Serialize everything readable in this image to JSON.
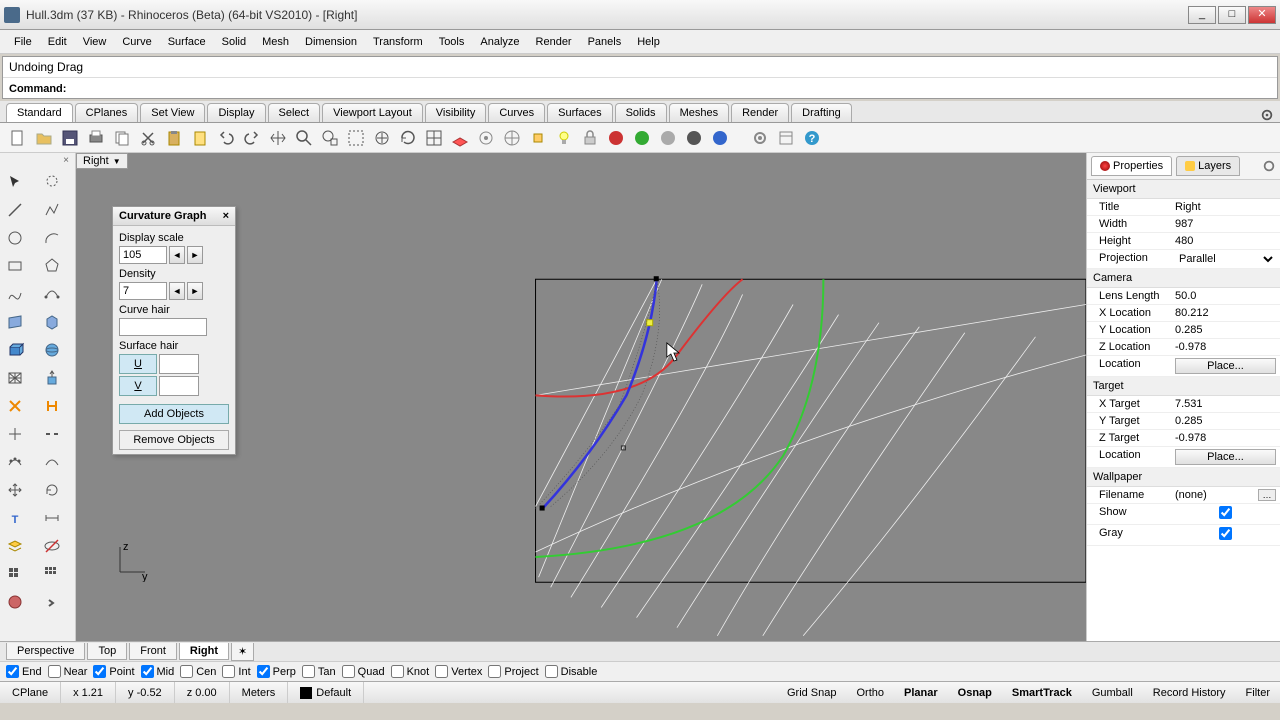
{
  "window": {
    "title": "Hull.3dm (37 KB) - Rhinoceros (Beta) (64-bit VS2010) - [Right]"
  },
  "menu": [
    "File",
    "Edit",
    "View",
    "Curve",
    "Surface",
    "Solid",
    "Mesh",
    "Dimension",
    "Transform",
    "Tools",
    "Analyze",
    "Render",
    "Panels",
    "Help"
  ],
  "command_history": "Undoing Drag",
  "command_prompt": "Command:",
  "toolbar_tabs": [
    "Standard",
    "CPlanes",
    "Set View",
    "Display",
    "Select",
    "Viewport Layout",
    "Visibility",
    "Curves",
    "Surfaces",
    "Solids",
    "Meshes",
    "Render",
    "Drafting"
  ],
  "viewport_label": "Right",
  "curvature_graph": {
    "title": "Curvature Graph",
    "display_scale_label": "Display scale",
    "display_scale": "105",
    "density_label": "Density",
    "density": "7",
    "curve_hair_label": "Curve hair",
    "surface_hair_label": "Surface hair",
    "u_label": "U",
    "v_label": "V",
    "add": "Add Objects",
    "remove": "Remove Objects"
  },
  "prop_tabs": {
    "properties": "Properties",
    "layers": "Layers"
  },
  "properties": {
    "viewport_section": "Viewport",
    "title_k": "Title",
    "title_v": "Right",
    "width_k": "Width",
    "width_v": "987",
    "height_k": "Height",
    "height_v": "480",
    "projection_k": "Projection",
    "projection_v": "Parallel",
    "camera_section": "Camera",
    "lens_k": "Lens Length",
    "lens_v": "50.0",
    "xloc_k": "X Location",
    "xloc_v": "80.212",
    "yloc_k": "Y Location",
    "yloc_v": "0.285",
    "zloc_k": "Z Location",
    "zloc_v": "-0.978",
    "loc_k": "Location",
    "place_btn": "Place...",
    "target_section": "Target",
    "xt_k": "X Target",
    "xt_v": "7.531",
    "yt_k": "Y Target",
    "yt_v": "0.285",
    "zt_k": "Z Target",
    "zt_v": "-0.978",
    "wallpaper_section": "Wallpaper",
    "file_k": "Filename",
    "file_v": "(none)",
    "show_k": "Show",
    "gray_k": "Gray"
  },
  "viewport_tabs": [
    "Perspective",
    "Top",
    "Front",
    "Right"
  ],
  "osnap": {
    "end": "End",
    "near": "Near",
    "point": "Point",
    "mid": "Mid",
    "cen": "Cen",
    "int": "Int",
    "perp": "Perp",
    "tan": "Tan",
    "quad": "Quad",
    "knot": "Knot",
    "vertex": "Vertex",
    "project": "Project",
    "disable": "Disable"
  },
  "status": {
    "cplane": "CPlane",
    "x": "x 1.21",
    "y": "y -0.52",
    "z": "z 0.00",
    "units": "Meters",
    "layer": "Default",
    "gridsnap": "Grid Snap",
    "ortho": "Ortho",
    "planar": "Planar",
    "osnap": "Osnap",
    "smarttrack": "SmartTrack",
    "gumball": "Gumball",
    "record": "Record History",
    "filter": "Filter"
  },
  "axis": {
    "z": "z",
    "y": "y"
  }
}
